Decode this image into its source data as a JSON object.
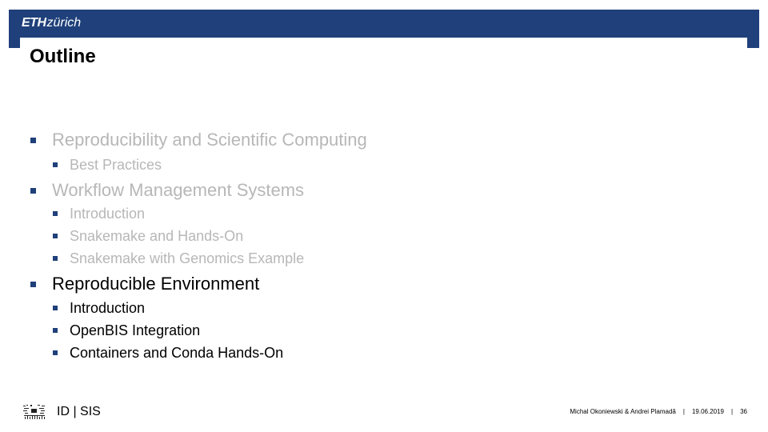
{
  "header": {
    "brand_bold": "ETH",
    "brand_light": "zürich",
    "brand_color": "#1f407a"
  },
  "slide": {
    "title": "Outline"
  },
  "outline": [
    {
      "label": "Reproducibility and Scientific Computing",
      "state": "faded",
      "children": [
        {
          "label": "Best Practices"
        }
      ]
    },
    {
      "label": "Workflow Management Systems",
      "state": "faded",
      "children": [
        {
          "label": "Introduction"
        },
        {
          "label": "Snakemake and Hands-On"
        },
        {
          "label": "Snakemake with Genomics Example"
        }
      ]
    },
    {
      "label": "Reproducible Environment",
      "state": "active",
      "children": [
        {
          "label": "Introduction"
        },
        {
          "label": "OpenBIS Integration"
        },
        {
          "label": "Containers and Conda Hands-On"
        }
      ]
    }
  ],
  "footer": {
    "department": "ID | SIS",
    "authors": "Michal Okoniewski & Andrei Plamadă",
    "separator": "|",
    "date": "19.06.2019",
    "page_number": "36"
  }
}
